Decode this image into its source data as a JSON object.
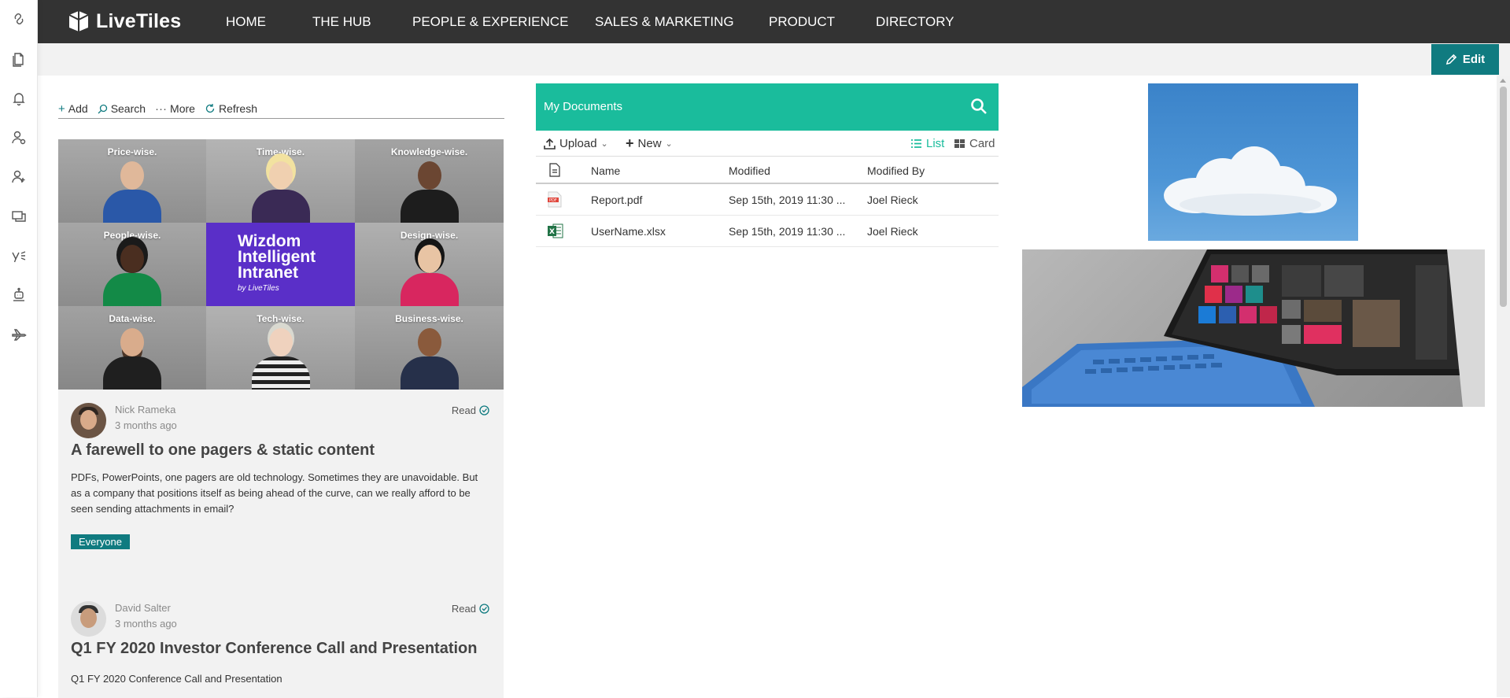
{
  "brand": {
    "name": "LiveTiles"
  },
  "nav": {
    "items": [
      "HOME",
      "THE HUB",
      "PEOPLE & EXPERIENCE",
      "SALES & MARKETING",
      "PRODUCT",
      "DIRECTORY"
    ]
  },
  "rail": {
    "icons": [
      "link-icon",
      "documents-icon",
      "bell-icon",
      "user-gear-icon",
      "add-user-icon",
      "chat-icon",
      "yammer-icon",
      "bot-icon",
      "plane-icon"
    ]
  },
  "editbar": {
    "edit_label": "Edit"
  },
  "news": {
    "toolbar": {
      "add": "Add",
      "search": "Search",
      "more": "More",
      "refresh": "Refresh"
    },
    "hero": {
      "tiles": [
        "Price-wise.",
        "Time-wise.",
        "Knowledge-wise.",
        "People-wise.",
        "",
        "Design-wise.",
        "Data-wise.",
        "Tech-wise.",
        "Business-wise."
      ],
      "wizdom_title": "Wizdom Intelligent Intranet",
      "wizdom_by": "by LiveTiles"
    },
    "posts": [
      {
        "author": "Nick Rameka",
        "ago": "3 months ago",
        "read": "Read",
        "title": "A farewell to one pagers & static content",
        "body": "PDFs, PowerPoints, one pagers are old technology. Sometimes they are unavoidable. But as a company that positions itself as being ahead of the curve, can we really afford to be seen sending attachments in email?",
        "tag": "Everyone"
      },
      {
        "author": "David Salter",
        "ago": "3 months ago",
        "read": "Read",
        "title": "Q1 FY 2020 Investor Conference Call and Presentation",
        "body": "Q1 FY 2020 Conference Call and Presentation"
      }
    ]
  },
  "docs": {
    "title": "My Documents",
    "toolbar": {
      "upload": "Upload",
      "new": "New",
      "list": "List",
      "card": "Card"
    },
    "columns": {
      "name": "Name",
      "modified": "Modified",
      "modified_by": "Modified By"
    },
    "rows": [
      {
        "name": "Report.pdf",
        "modified": "Sep 15th, 2019 11:30 ...",
        "modified_by": "Joel Rieck",
        "type": "pdf"
      },
      {
        "name": "UserName.xlsx",
        "modified": "Sep 15th, 2019 11:30 ...",
        "modified_by": "Joel Rieck",
        "type": "xlsx"
      }
    ]
  },
  "colors": {
    "nav_bg": "#333333",
    "accent_teal": "#107b80",
    "docs_header": "#1abc9c",
    "wizdom_purple": "#5a2fc8"
  }
}
